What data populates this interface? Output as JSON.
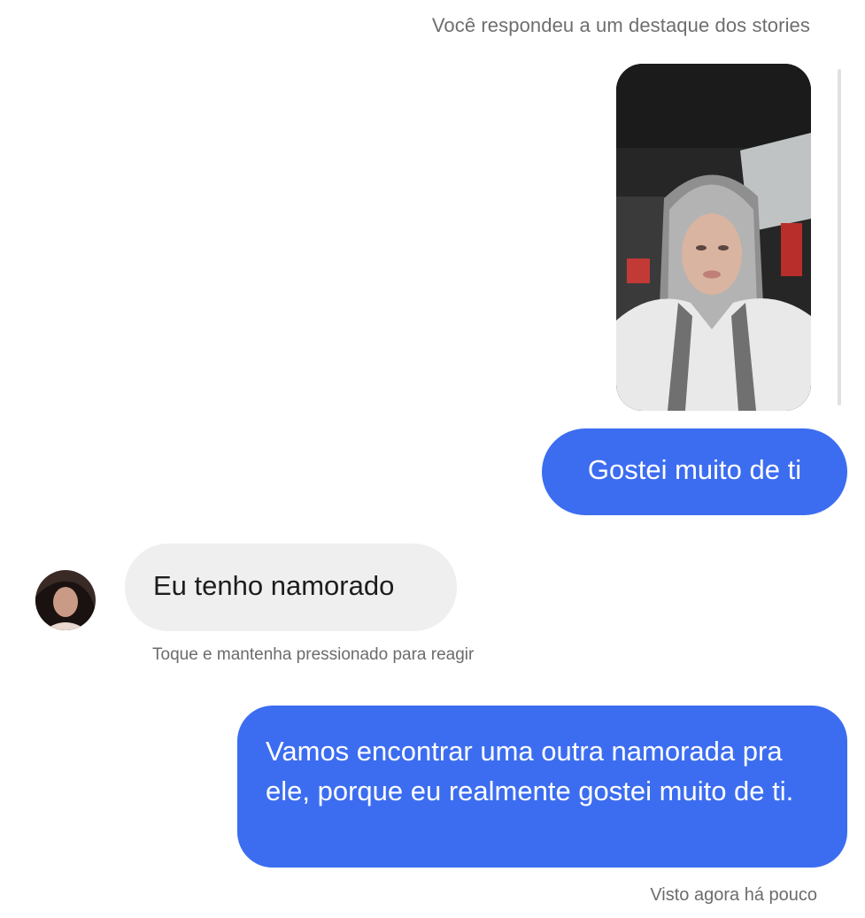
{
  "conversation": {
    "story_reply_label": "Você respondeu a um destaque dos stories",
    "messages": [
      {
        "sender": "me",
        "text": "Gostei muito de ti"
      },
      {
        "sender": "them",
        "text": "Eu tenho namorado"
      },
      {
        "sender": "me",
        "text": "Vamos encontrar uma outra namorada pra ele, porque eu realmente gostei muito de ti."
      }
    ],
    "react_hint": "Toque e mantenha pressionado para reagir",
    "seen_status": "Visto agora há pouco"
  },
  "colors": {
    "outgoing_bubble": "#3c6df0",
    "incoming_bubble": "#efefef",
    "meta_text": "#6e6e6e"
  }
}
